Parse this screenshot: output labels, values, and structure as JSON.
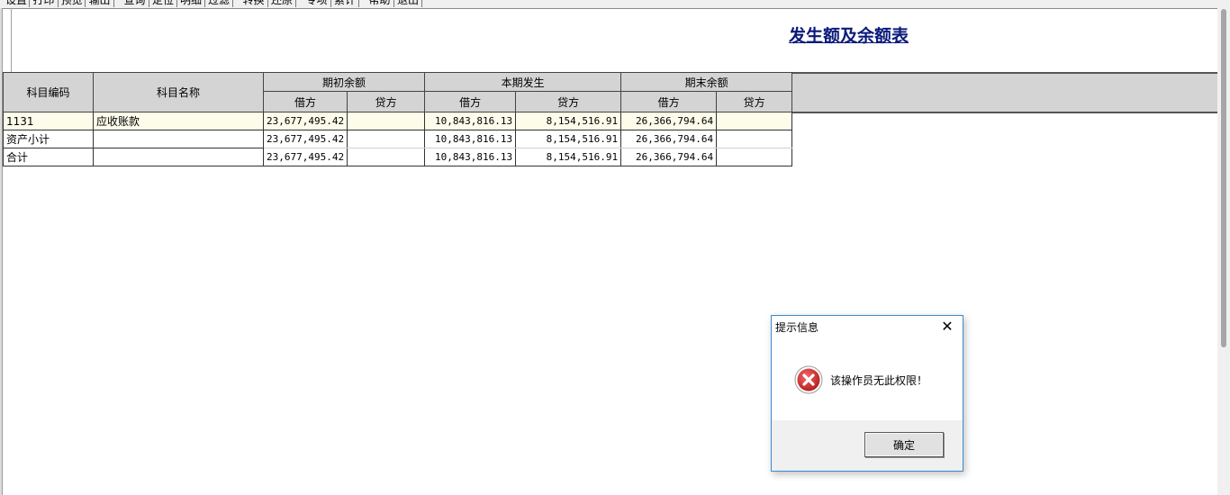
{
  "toolbar": {
    "buttons": [
      "设置",
      "打印",
      "预览",
      "输出",
      "查询",
      "定位",
      "明细",
      "过滤",
      "转换",
      "还原",
      "专项",
      "累计",
      "帮助",
      "退出"
    ]
  },
  "report": {
    "title": "发生额及余额表"
  },
  "table": {
    "headers": {
      "code": "科目编码",
      "name": "科目名称",
      "opening": "期初余额",
      "current": "本期发生",
      "closing": "期末余额",
      "debit": "借方",
      "credit": "贷方"
    },
    "rows": [
      {
        "code": "1131",
        "name": "应收账款",
        "opening_debit": "23,677,495.42",
        "opening_credit": "",
        "current_debit": "10,843,816.13",
        "current_credit": "8,154,516.91",
        "closing_debit": "26,366,794.64",
        "closing_credit": ""
      },
      {
        "code": "资产小计",
        "name": "",
        "opening_debit": "23,677,495.42",
        "opening_credit": "",
        "current_debit": "10,843,816.13",
        "current_credit": "8,154,516.91",
        "closing_debit": "26,366,794.64",
        "closing_credit": ""
      },
      {
        "code": "合计",
        "name": "",
        "opening_debit": "23,677,495.42",
        "opening_credit": "",
        "current_debit": "10,843,816.13",
        "current_credit": "8,154,516.91",
        "closing_debit": "26,366,794.64",
        "closing_credit": ""
      }
    ]
  },
  "dialog": {
    "title": "提示信息",
    "close": "✕",
    "message": "该操作员无此权限！",
    "ok_label": "确定",
    "icon": "error-icon"
  },
  "colors": {
    "title_text": "#0a1a7a",
    "dialog_border": "#3c8ad1",
    "error_red": "#c62828"
  }
}
